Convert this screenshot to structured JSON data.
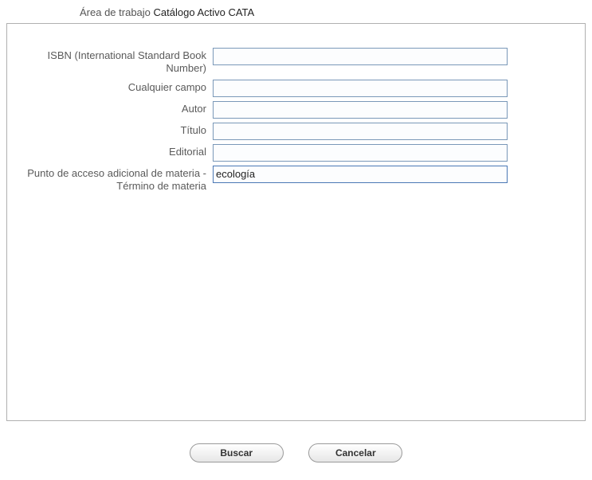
{
  "header": {
    "workspace_label": "Área de trabajo ",
    "catalog_label": "Catálogo Activo CATA"
  },
  "form": {
    "isbn": {
      "label": "ISBN (International Standard Book Number)",
      "value": ""
    },
    "any_field": {
      "label": "Cualquier campo",
      "value": ""
    },
    "author": {
      "label": "Autor",
      "value": ""
    },
    "title": {
      "label": "Título",
      "value": ""
    },
    "publisher": {
      "label": "Editorial",
      "value": ""
    },
    "subject": {
      "label": "Punto de acceso adicional de materia - Término de materia",
      "value": "ecología"
    }
  },
  "buttons": {
    "search": "Buscar",
    "cancel": "Cancelar"
  }
}
